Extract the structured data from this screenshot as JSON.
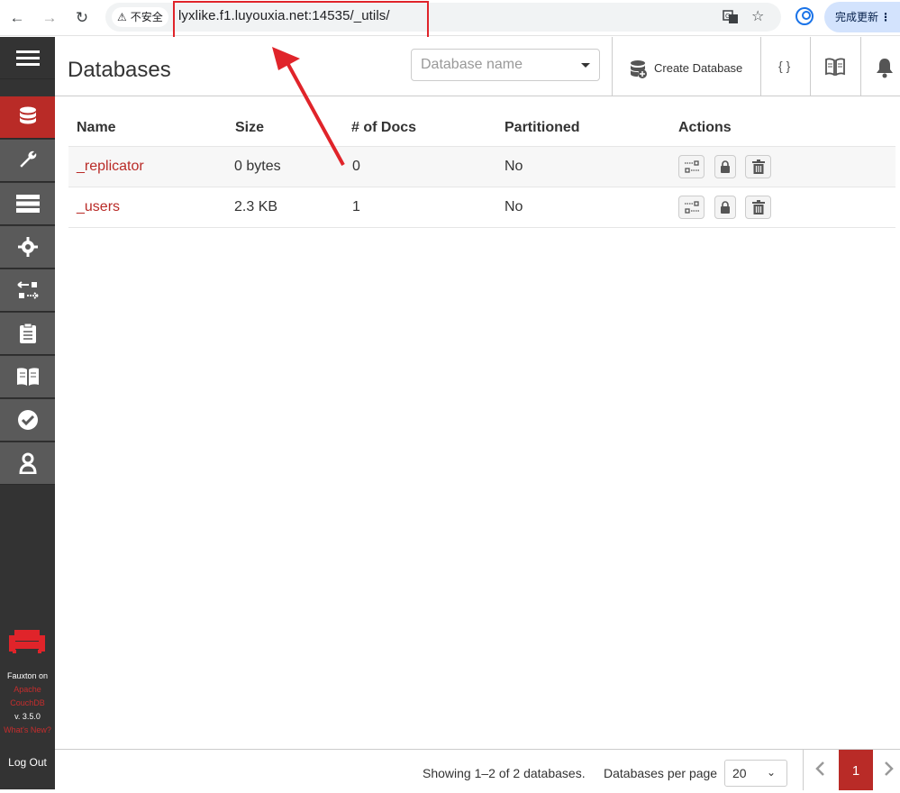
{
  "browser": {
    "security_label": "不安全",
    "url": "lyxlike.f1.luyouxia.net:14535/_utils/",
    "update_label": "完成更新"
  },
  "sidebar": {
    "fauxton_on": "Fauxton on",
    "apache": "Apache",
    "couchdb": "CouchDB",
    "version": "v. 3.5.0",
    "whats_new": "What's New?",
    "logout": "Log Out"
  },
  "header": {
    "title": "Databases",
    "search_placeholder": "Database name",
    "create_db_label": "Create Database",
    "json_label": "{ }"
  },
  "table": {
    "columns": [
      "Name",
      "Size",
      "# of Docs",
      "Partitioned",
      "Actions"
    ],
    "rows": [
      {
        "name": "_replicator",
        "size": "0 bytes",
        "docs": "0",
        "partitioned": "No"
      },
      {
        "name": "_users",
        "size": "2.3 KB",
        "docs": "1",
        "partitioned": "No"
      }
    ]
  },
  "footer": {
    "showing": "Showing 1–2 of 2 databases.",
    "per_page_label": "Databases per page",
    "per_page_value": "20",
    "current_page": "1"
  },
  "colors": {
    "accent": "#b92b27",
    "sidebar_bg": "#333333",
    "annotation": "#e0242a"
  }
}
